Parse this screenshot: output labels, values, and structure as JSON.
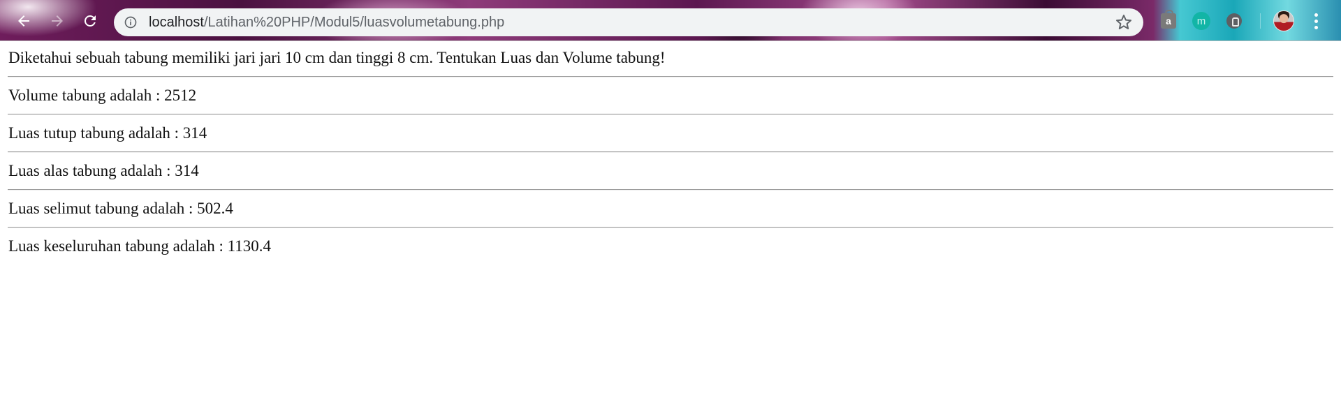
{
  "browser": {
    "url_host": "localhost",
    "url_path": "/Latihan%20PHP/Modul5/luasvolumetabung.php",
    "extensions": {
      "shopping_label": "a",
      "m_label": "m"
    }
  },
  "page": {
    "lines": [
      "Diketahui sebuah tabung memiliki jari jari 10 cm dan tinggi 8 cm. Tentukan Luas dan Volume tabung!",
      "Volume tabung adalah : 2512",
      "Luas tutup tabung adalah : 314",
      "Luas alas tabung adalah : 314",
      "Luas selimut tabung adalah : 502.4",
      "Luas keseluruhan tabung adalah : 1130.4"
    ]
  }
}
